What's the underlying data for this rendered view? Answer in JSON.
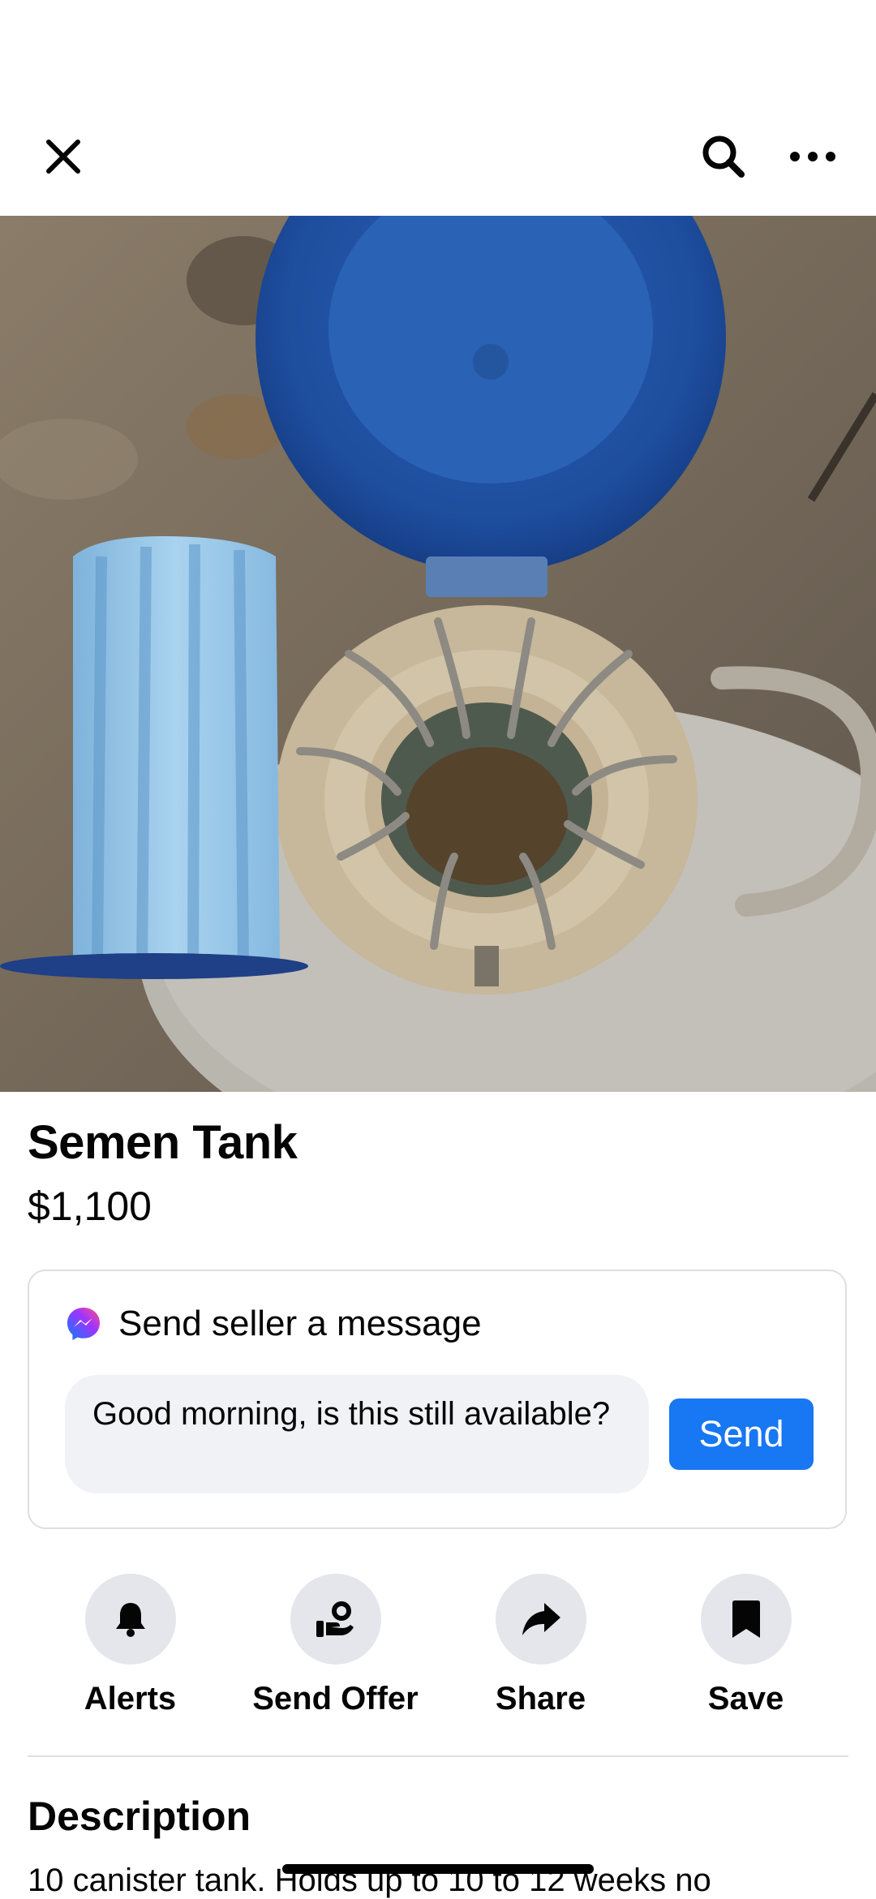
{
  "header": {
    "close_icon": "close-icon",
    "search_icon": "search-icon",
    "more_icon": "more-horizontal-icon"
  },
  "gallery": {
    "image_description": "open blue-lidded cryogenic tank with canisters beside a blue foam insulator",
    "dot_count": 5,
    "active_index": 0
  },
  "listing": {
    "title": "Semen Tank",
    "price": "$1,100"
  },
  "message": {
    "heading": "Send seller a message",
    "icon": "messenger-icon",
    "input_value": "Good morning, is this still available?",
    "send_label": "Send",
    "accent": "#1877f2"
  },
  "actions": [
    {
      "label": "Alerts",
      "icon": "bell-icon"
    },
    {
      "label": "Send Offer",
      "icon": "offer-hand-icon"
    },
    {
      "label": "Share",
      "icon": "share-arrow-icon"
    },
    {
      "label": "Save",
      "icon": "bookmark-icon"
    }
  ],
  "description": {
    "heading": "Description",
    "text": "10 canister tank. Holds up to 10 to 12 weeks no"
  }
}
